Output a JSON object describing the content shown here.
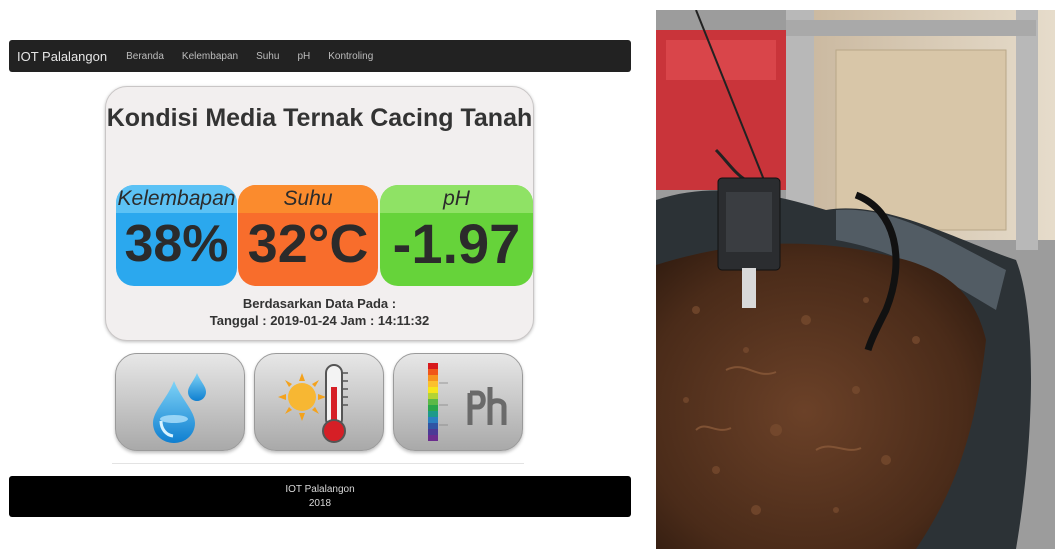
{
  "navbar": {
    "brand": "IOT Palalangon",
    "items": [
      "Beranda",
      "Kelembapan",
      "Suhu",
      "pH",
      "Kontroling"
    ]
  },
  "card": {
    "title": "Kondisi Media Ternak Cacing Tanah",
    "tiles": [
      {
        "label": "Kelembapan",
        "value": "38%",
        "color": "#2ba8ee"
      },
      {
        "label": "Suhu",
        "value": "32°C",
        "color": "#f86d2c"
      },
      {
        "label": "pH",
        "value": "-1.97",
        "color": "#66d33a"
      }
    ],
    "caption_line1": "Berdasarkan Data Pada :",
    "caption_line2": "Tanggal : 2019-01-24 Jam : 14:11:32"
  },
  "icons": [
    "water-drop-icon",
    "thermometer-sun-icon",
    "ph-scale-icon"
  ],
  "footer": {
    "line1": "IOT Palalangon",
    "line2": "2018"
  },
  "photo": {
    "icon": "soil-sensor-photo"
  }
}
